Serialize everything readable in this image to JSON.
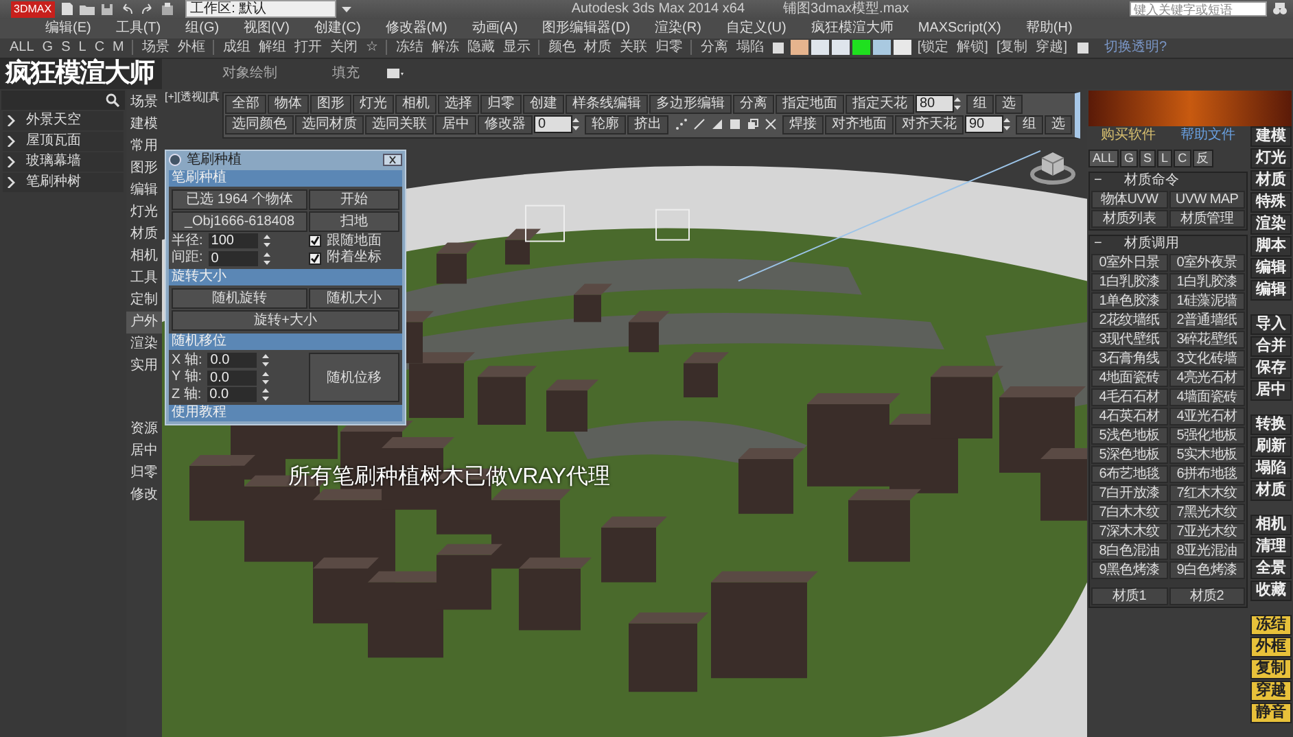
{
  "title_bar": {
    "badge": "3DMAX",
    "workspace": "工作区: 默认",
    "title": "Autodesk 3ds Max  2014 x64",
    "file": "铺图3dmax模型.max",
    "search": {
      "placeholder": "键入关键字或短语"
    }
  },
  "menu": [
    "编辑(E)",
    "工具(T)",
    "组(G)",
    "视图(V)",
    "创建(C)",
    "修改器(M)",
    "动画(A)",
    "图形编辑器(D)",
    "渲染(R)",
    "自定义(U)",
    "疯狂模渲大师",
    "MAXScript(X)",
    "帮助(H)"
  ],
  "toolbar": {
    "filters": [
      "ALL",
      "G",
      "S",
      "L",
      "C",
      "M"
    ],
    "groups": [
      [
        "场景",
        "外框"
      ],
      [
        "成组",
        "解组",
        "打开",
        "关闭",
        "☆"
      ],
      [
        "冻结",
        "解冻",
        "隐藏",
        "显示"
      ],
      [
        "颜色",
        "材质",
        "关联",
        "归零"
      ],
      [
        "分离",
        "塌陷"
      ]
    ],
    "swatches": [
      {
        "color": "#e6b48e"
      },
      {
        "color": "#dfe5ec"
      },
      {
        "color": "#dfe5ec"
      },
      {
        "color": "#1fe01f"
      },
      {
        "color": "#a9c9e0"
      },
      {
        "color": "#e8e8e8"
      }
    ],
    "actions": [
      "[锁定",
      "解锁]",
      "[复制",
      "穿越]"
    ],
    "link": "切换透明?"
  },
  "brand": {
    "title": "疯狂模渲大师",
    "tabs": [
      "对象绘制",
      "填充"
    ]
  },
  "tree": [
    {
      "label": "外景天空",
      "expanded": false
    },
    {
      "label": "屋顶瓦面",
      "expanded": false
    },
    {
      "label": "玻璃幕墙",
      "expanded": false
    },
    {
      "label": "笔刷种树",
      "expanded": false
    }
  ],
  "categories": [
    {
      "label": "场景",
      "selected": false
    },
    {
      "label": "建模",
      "selected": false
    },
    {
      "label": "常用",
      "selected": false
    },
    {
      "label": "图形",
      "selected": false
    },
    {
      "label": "编辑",
      "selected": false
    },
    {
      "label": "灯光",
      "selected": false
    },
    {
      "label": "材质",
      "selected": false
    },
    {
      "label": "相机",
      "selected": false
    },
    {
      "label": "工具",
      "selected": false
    },
    {
      "label": "定制",
      "selected": false
    },
    {
      "label": "户外",
      "selected": true
    },
    {
      "label": "渲染",
      "selected": false
    },
    {
      "label": "实用",
      "selected": false
    }
  ],
  "categories_lower": [
    "资源",
    "居中",
    "归零",
    "修改"
  ],
  "viewport": {
    "label": "[+][透视][真"
  },
  "viewport_toolbar": {
    "top_row": [
      {
        "kind": "button",
        "label": "全部"
      },
      {
        "kind": "button",
        "label": "物体"
      },
      {
        "kind": "button",
        "label": "图形"
      },
      {
        "kind": "button",
        "label": "灯光"
      },
      {
        "kind": "button",
        "label": "相机"
      },
      {
        "kind": "button",
        "label": "选择"
      },
      {
        "kind": "button",
        "label": "归零"
      },
      {
        "kind": "button",
        "label": "创建"
      },
      {
        "kind": "button",
        "label": "样条线编辑"
      },
      {
        "kind": "button",
        "label": "多边形编辑"
      },
      {
        "kind": "button",
        "label": "分离"
      },
      {
        "kind": "button",
        "label": "指定地面"
      },
      {
        "kind": "button",
        "label": "指定天花"
      },
      {
        "kind": "spinner",
        "value": "80"
      },
      {
        "kind": "button",
        "label": "组"
      },
      {
        "kind": "button",
        "label": "选"
      }
    ],
    "bottom_row": [
      {
        "kind": "button",
        "label": "选同颜色"
      },
      {
        "kind": "button",
        "label": "选同材质"
      },
      {
        "kind": "button",
        "label": "选同关联"
      },
      {
        "kind": "button",
        "label": "居中"
      },
      {
        "kind": "button",
        "label": "修改器"
      },
      {
        "kind": "spinner",
        "value": "0"
      },
      {
        "kind": "button",
        "label": "轮廓"
      },
      {
        "kind": "button",
        "label": "挤出"
      },
      {
        "kind": "tool_icons"
      },
      {
        "kind": "button",
        "label": "焊接"
      },
      {
        "kind": "button",
        "label": "对齐地面"
      },
      {
        "kind": "button",
        "label": "对齐天花"
      },
      {
        "kind": "spinner",
        "value": "90"
      },
      {
        "kind": "button",
        "label": "组"
      },
      {
        "kind": "button",
        "label": "选"
      }
    ]
  },
  "subtitle": "所有笔刷种植树木已做VRAY代理",
  "brush_dialog": {
    "title": "笔刷种植",
    "sections": [
      {
        "title": "笔刷种植",
        "items": [
          {
            "kind": "button",
            "label": "已选 1964 个物体"
          },
          {
            "kind": "button",
            "label": "开始"
          },
          {
            "kind": "button",
            "label": "_Obj1666-618408"
          },
          {
            "kind": "button",
            "label": "扫地"
          },
          {
            "kind": "field",
            "label": "半径:",
            "value": "100"
          },
          {
            "kind": "checkbox",
            "label": "跟随地面",
            "checked": true
          },
          {
            "kind": "field",
            "label": "间距:",
            "value": "0"
          },
          {
            "kind": "checkbox",
            "label": "附着坐标",
            "checked": true
          }
        ]
      },
      {
        "title": "旋转大小",
        "items": [
          {
            "kind": "button",
            "label": "随机旋转"
          },
          {
            "kind": "button",
            "label": "随机大小"
          },
          {
            "kind": "wide_button",
            "label": "旋转+大小"
          }
        ]
      },
      {
        "title": "随机移位",
        "items": [
          {
            "kind": "field",
            "label": "X 轴:",
            "value": "0.0"
          },
          {
            "kind": "field",
            "label": "Y 轴:",
            "value": "0.0"
          },
          {
            "kind": "field",
            "label": "Z 轴:",
            "value": "0.0"
          },
          {
            "kind": "tall_button",
            "label": "随机位移"
          }
        ]
      },
      {
        "title": "使用教程"
      }
    ]
  },
  "right_panel": {
    "links": [
      {
        "label": "购买软件",
        "color": "#d8c070"
      },
      {
        "label": "帮助文件",
        "color": "#6aa0e0"
      }
    ],
    "filters": [
      "ALL",
      "G",
      "S",
      "L",
      "C",
      "反"
    ],
    "groups": [
      {
        "toggle": "−",
        "title": "材质命令",
        "items": [
          "物体UVW",
          "UVW MAP",
          "材质列表",
          "材质管理"
        ]
      },
      {
        "toggle": "−",
        "title": "材质调用",
        "items": [
          "0室外日景",
          "0室外夜景",
          "1白乳胶漆",
          "1白乳胶漆",
          "1单色胶漆",
          "1硅藻泥墙",
          "2花纹墙纸",
          "2普通墙纸",
          "3现代壁纸",
          "3碎花壁纸",
          "3石膏角线",
          "3文化砖墙",
          "4地面瓷砖",
          "4亮光石材",
          "4毛石石材",
          "4墙面瓷砖",
          "4石英石材",
          "4亚光石材",
          "5浅色地板",
          "5强化地板",
          "5深色地板",
          "5实木地板",
          "6布艺地毯",
          "6拼布地毯",
          "7白开放漆",
          "7红木木纹",
          "7白木木纹",
          "7黑光木纹",
          "7深木木纹",
          "7亚光木纹",
          "8白色混油",
          "8亚光混油",
          "9黑色烤漆",
          "9白色烤漆"
        ],
        "footer": [
          "材质1",
          "材质2"
        ]
      }
    ],
    "side_buttons": [
      {
        "kind": "gray",
        "labels": [
          "建模",
          "灯光",
          "材质",
          "特殊",
          "渲染",
          "脚本",
          "编辑",
          "编辑"
        ]
      },
      {
        "kind": "gray",
        "labels": [
          "导入",
          "合并",
          "保存",
          "居中"
        ]
      },
      {
        "kind": "gray",
        "labels": [
          "转换",
          "刷新",
          "塌陷",
          "材质"
        ]
      },
      {
        "kind": "gray",
        "labels": [
          "相机",
          "清理",
          "全景",
          "收藏"
        ]
      },
      {
        "kind": "yellow",
        "labels": [
          "冻结",
          "外框",
          "复制",
          "穿越",
          "静音"
        ]
      }
    ]
  }
}
